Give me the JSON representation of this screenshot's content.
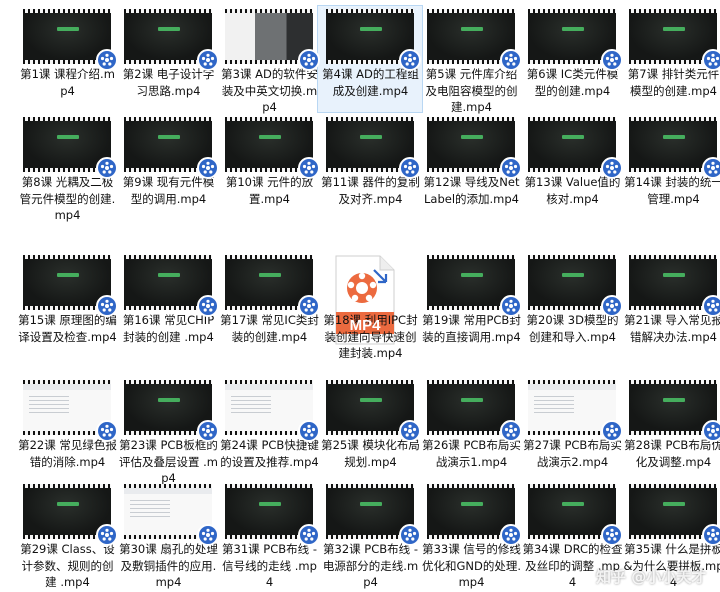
{
  "files": [
    {
      "name": "第1课 课程介绍.mp4",
      "thumb": "dark"
    },
    {
      "name": "第2课 电子设计学习思路.mp4",
      "thumb": "dark"
    },
    {
      "name": "第3课 AD的软件安装及中英文切换.mp4",
      "thumb": "mixed"
    },
    {
      "name": "第4课 AD的工程组成及创建.mp4",
      "thumb": "dark",
      "selected": true
    },
    {
      "name": "第5课 元件库介绍及电阻容模型的创建.mp4",
      "thumb": "dark"
    },
    {
      "name": "第6课 IC类元件模型的创建.mp4",
      "thumb": "dark"
    },
    {
      "name": "第7课 排针类元件模型的创建.mp4",
      "thumb": "dark"
    },
    {
      "name": "第8课 光耦及二极管元件模型的创建.mp4",
      "thumb": "dark"
    },
    {
      "name": "第9课 现有元件模型的调用.mp4",
      "thumb": "dark"
    },
    {
      "name": "第10课 元件的放置.mp4",
      "thumb": "dark"
    },
    {
      "name": "第11课 器件的复制及对齐.mp4",
      "thumb": "dark"
    },
    {
      "name": "第12课 导线及NetLabel的添加.mp4",
      "thumb": "dark"
    },
    {
      "name": "第13课 Value值的核对.mp4",
      "thumb": "dark"
    },
    {
      "name": "第14课 封装的统一管理.mp4",
      "thumb": "dark"
    },
    {
      "name": "第15课 原理图的编译设置及检查.mp4",
      "thumb": "dark"
    },
    {
      "name": "第16课 常见CHIP封装的创建 .mp4",
      "thumb": "dark"
    },
    {
      "name": "第17课 常见IC类封装的创建.mp4",
      "thumb": "dark"
    },
    {
      "name": "第18课 利用IPC封装创建向导快速创建封装.mp4",
      "thumb": "mp4icon"
    },
    {
      "name": "第19课 常用PCB封装的直接调用.mp4",
      "thumb": "dark"
    },
    {
      "name": "第20课 3D模型的创建和导入.mp4",
      "thumb": "dark"
    },
    {
      "name": "第21课 导入常见报错解决办法.mp4",
      "thumb": "dark"
    },
    {
      "name": "第22课 常见绿色报错的消除.mp4",
      "thumb": "bright"
    },
    {
      "name": "第23课 PCB板框的评估及叠层设置 .mp4",
      "thumb": "dark"
    },
    {
      "name": "第24课 PCB快捷键的设置及推荐.mp4",
      "thumb": "bright"
    },
    {
      "name": "第25课 模块化布局规划.mp4",
      "thumb": "dark"
    },
    {
      "name": "第26课 PCB布局实战演示1.mp4",
      "thumb": "dark"
    },
    {
      "name": "第27课 PCB布局实战演示2.mp4",
      "thumb": "bright"
    },
    {
      "name": "第28课 PCB布局优化及调整.mp4",
      "thumb": "dark"
    },
    {
      "name": "第29课 Class、设计参数、规则的创建 .mp4",
      "thumb": "dark"
    },
    {
      "name": "第30课 扇孔的处理及敷铜插件的应用.mp4",
      "thumb": "bright"
    },
    {
      "name": "第31课 PCB布线 - 信号线的走线 .mp4",
      "thumb": "dark"
    },
    {
      "name": "第32课 PCB布线 - 电源部分的走线.mp4",
      "thumb": "dark"
    },
    {
      "name": "第33课 信号的修线优化和GND的处理.mp4",
      "thumb": "dark"
    },
    {
      "name": "第34课 DRC的检查及丝印的调整 .mp4",
      "thumb": "dark"
    },
    {
      "name": "第35课 什么是拼板&为什么要拼板.mp4",
      "thumb": "dark"
    }
  ],
  "mp4_icon_text": "MP4",
  "watermark": "知乎 @小小天才",
  "colors": {
    "badge": "#2f66c7",
    "mp4_orange": "#ec6a3f",
    "selection": "#e8f2fc"
  }
}
